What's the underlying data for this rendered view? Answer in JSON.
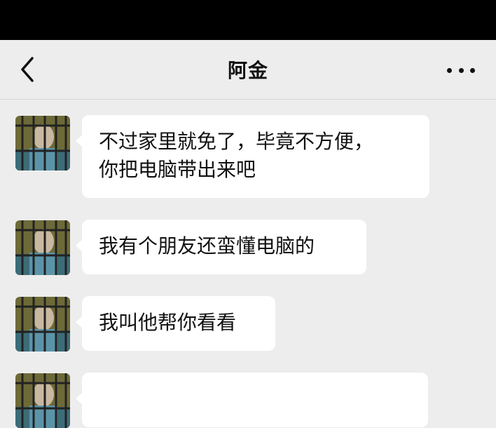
{
  "header": {
    "title": "阿金"
  },
  "icons": {
    "back": "chevron-left-icon",
    "more": "more-dots-icon"
  },
  "colors": {
    "background": "#ededed",
    "bubble": "#ffffff",
    "statusbar": "#000000",
    "text": "#111111"
  },
  "messages": [
    {
      "sender": "阿金",
      "text": "不过家里就免了，毕竟不方便，\n你把电脑带出来吧"
    },
    {
      "sender": "阿金",
      "text": "我有个朋友还蛮懂电脑的"
    },
    {
      "sender": "阿金",
      "text": "我叫他帮你看看"
    },
    {
      "sender": "阿金",
      "text": ""
    }
  ]
}
